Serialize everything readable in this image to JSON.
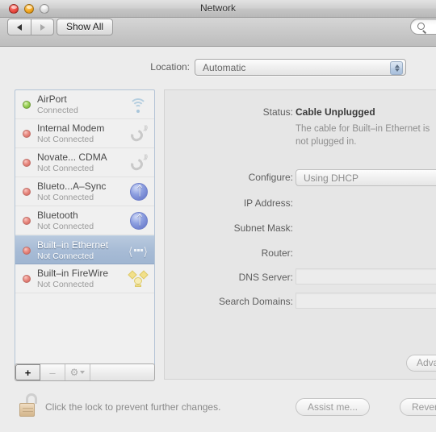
{
  "window": {
    "title": "Network",
    "traffic_lights": [
      "close-button",
      "minimize-button",
      "zoom-button"
    ]
  },
  "toolbar": {
    "back_label": "◀",
    "forward_label": "▶",
    "show_all_label": "Show All",
    "search_placeholder": "",
    "search_icon": "search-icon"
  },
  "location": {
    "label": "Location:",
    "value": "Automatic",
    "options": [
      "Automatic"
    ]
  },
  "sidebar": {
    "items": [
      {
        "name": "AirPort",
        "status": "Connected",
        "dot": "green",
        "icon": "wifi-icon",
        "selected": false
      },
      {
        "name": "Internal Modem",
        "status": "Not Connected",
        "dot": "red",
        "icon": "modem-icon",
        "selected": false
      },
      {
        "name": "Novate... CDMA",
        "status": "Not Connected",
        "dot": "red",
        "icon": "modem-icon",
        "selected": false
      },
      {
        "name": "Blueto...A–Sync",
        "status": "Not Connected",
        "dot": "red",
        "icon": "bluetooth-icon",
        "selected": false
      },
      {
        "name": "Bluetooth",
        "status": "Not Connected",
        "dot": "red",
        "icon": "bluetooth-icon",
        "selected": false
      },
      {
        "name": "Built–in Ethernet",
        "status": "Not Connected",
        "dot": "red",
        "icon": "ethernet-icon",
        "selected": true
      },
      {
        "name": "Built–in FireWire",
        "status": "Not Connected",
        "dot": "red",
        "icon": "firewire-icon",
        "selected": false
      }
    ],
    "toolbar": {
      "add_label": "+",
      "remove_label": "–",
      "actions_icon": "gear-icon"
    }
  },
  "detail": {
    "status_label": "Status:",
    "status_value": "Cable Unplugged",
    "status_detail": "The cable for Built–in Ethernet is not plugged in.",
    "configure_label": "Configure:",
    "configure_value": "Using DHCP",
    "configure_options": [
      "Using DHCP"
    ],
    "ip_label": "IP Address:",
    "ip_value": "",
    "subnet_label": "Subnet Mask:",
    "subnet_value": "",
    "router_label": "Router:",
    "router_value": "",
    "dns_label": "DNS Server:",
    "dns_value": "",
    "search_domains_label": "Search Domains:",
    "search_domains_value": "",
    "advanced_label": "Advanced..."
  },
  "footer": {
    "lock_icon": "unlocked-padlock-icon",
    "lock_text": "Click the lock to prevent further changes.",
    "assist_label": "Assist me...",
    "revert_label": "Revert"
  },
  "colors": {
    "window_bg": "#ececec",
    "selected_row": "#a8bcd6",
    "connected_dot": "#9ed35b",
    "disconnected_dot": "#e98b82",
    "bluetooth_blue": "#5e6fc4",
    "firewire_yellow": "#f2e08a"
  }
}
